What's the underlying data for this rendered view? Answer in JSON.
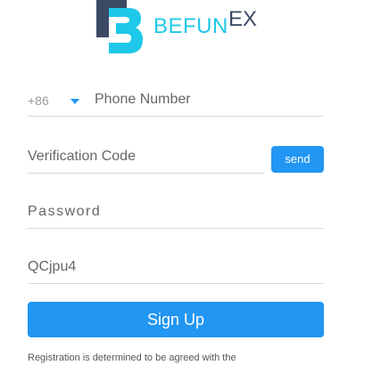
{
  "brand": {
    "name": "BEFUN",
    "suffix": "EX",
    "colors": {
      "cyan": "#1ec8e8",
      "navy": "#3c4a66"
    }
  },
  "form": {
    "country_code": "+86",
    "phone_placeholder": "Phone Number",
    "verification_placeholder": "Verification Code",
    "send_label": "send",
    "password_placeholder": "Password",
    "captcha_value": "QCjpu4",
    "signup_label": "Sign Up"
  },
  "colors": {
    "accent": "#2196f3"
  },
  "footer": {
    "terms_text": "Registration is determined to be agreed with the"
  }
}
